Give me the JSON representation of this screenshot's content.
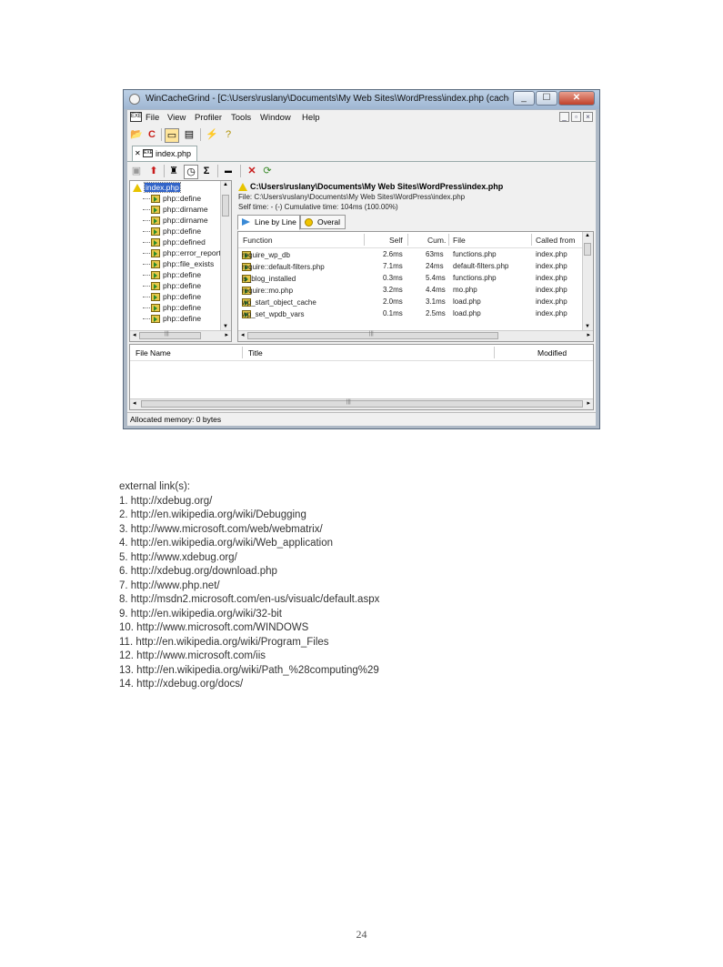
{
  "window": {
    "title": "WinCacheGrind - [C:\\Users\\ruslany\\Documents\\My Web Sites\\WordPress\\index.php (cachegrind.out...",
    "caption_buttons": [
      "_",
      "☐",
      "✕"
    ],
    "menu": [
      "File",
      "View",
      "Profiler",
      "Tools",
      "Window",
      "Help"
    ],
    "doc_tab": "index.php",
    "tree": {
      "root": "index.php",
      "items": [
        "php::define",
        "php::dirname",
        "php::dirname",
        "php::define",
        "php::defined",
        "php::error_reporti",
        "php::file_exists",
        "php::define",
        "php::define",
        "php::define",
        "php::define",
        "php::define"
      ]
    },
    "detail": {
      "path": "C:\\Users\\ruslany\\Documents\\My Web Sites\\WordPress\\index.php",
      "file": "File: C:\\Users\\ruslany\\Documents\\My Web Sites\\WordPress\\index.php",
      "self_time": "Self time: - (-)   Cumulative time: 104ms (100.00%)",
      "tabs": [
        "Line by Line",
        "Overal"
      ],
      "columns": [
        "Function",
        "Self",
        "Cum.",
        "File",
        "Called from"
      ],
      "rows": [
        [
          "require_wp_db",
          "2.6ms",
          "63ms",
          "functions.php",
          "index.php"
        ],
        [
          "require::default-filters.php",
          "7.1ms",
          "24ms",
          "default-filters.php",
          "index.php"
        ],
        [
          "is_blog_installed",
          "0.3ms",
          "5.4ms",
          "functions.php",
          "index.php"
        ],
        [
          "require::mo.php",
          "3.2ms",
          "4.4ms",
          "mo.php",
          "index.php"
        ],
        [
          "wp_start_object_cache",
          "2.0ms",
          "3.1ms",
          "load.php",
          "index.php"
        ],
        [
          "wp_set_wpdb_vars",
          "0.1ms",
          "2.5ms",
          "load.php",
          "index.php"
        ]
      ]
    },
    "bottom_columns": [
      "File Name",
      "Title",
      "Modified"
    ],
    "status": "Allocated memory: 0 bytes"
  },
  "links": {
    "heading": "external link(s):",
    "items": [
      "1. http://xdebug.org/",
      "2. http://en.wikipedia.org/wiki/Debugging",
      "3. http://www.microsoft.com/web/webmatrix/",
      "4. http://en.wikipedia.org/wiki/Web_application",
      "5. http://www.xdebug.org/",
      "6. http://xdebug.org/download.php",
      "7. http://www.php.net/",
      "8. http://msdn2.microsoft.com/en-us/visualc/default.aspx",
      "9. http://en.wikipedia.org/wiki/32-bit",
      "10. http://www.microsoft.com/WINDOWS",
      "11. http://en.wikipedia.org/wiki/Program_Files",
      "12. http://www.microsoft.com/iis",
      "13. http://en.wikipedia.org/wiki/Path_%28computing%29",
      "14. http://xdebug.org/docs/"
    ]
  },
  "page_number": "24"
}
